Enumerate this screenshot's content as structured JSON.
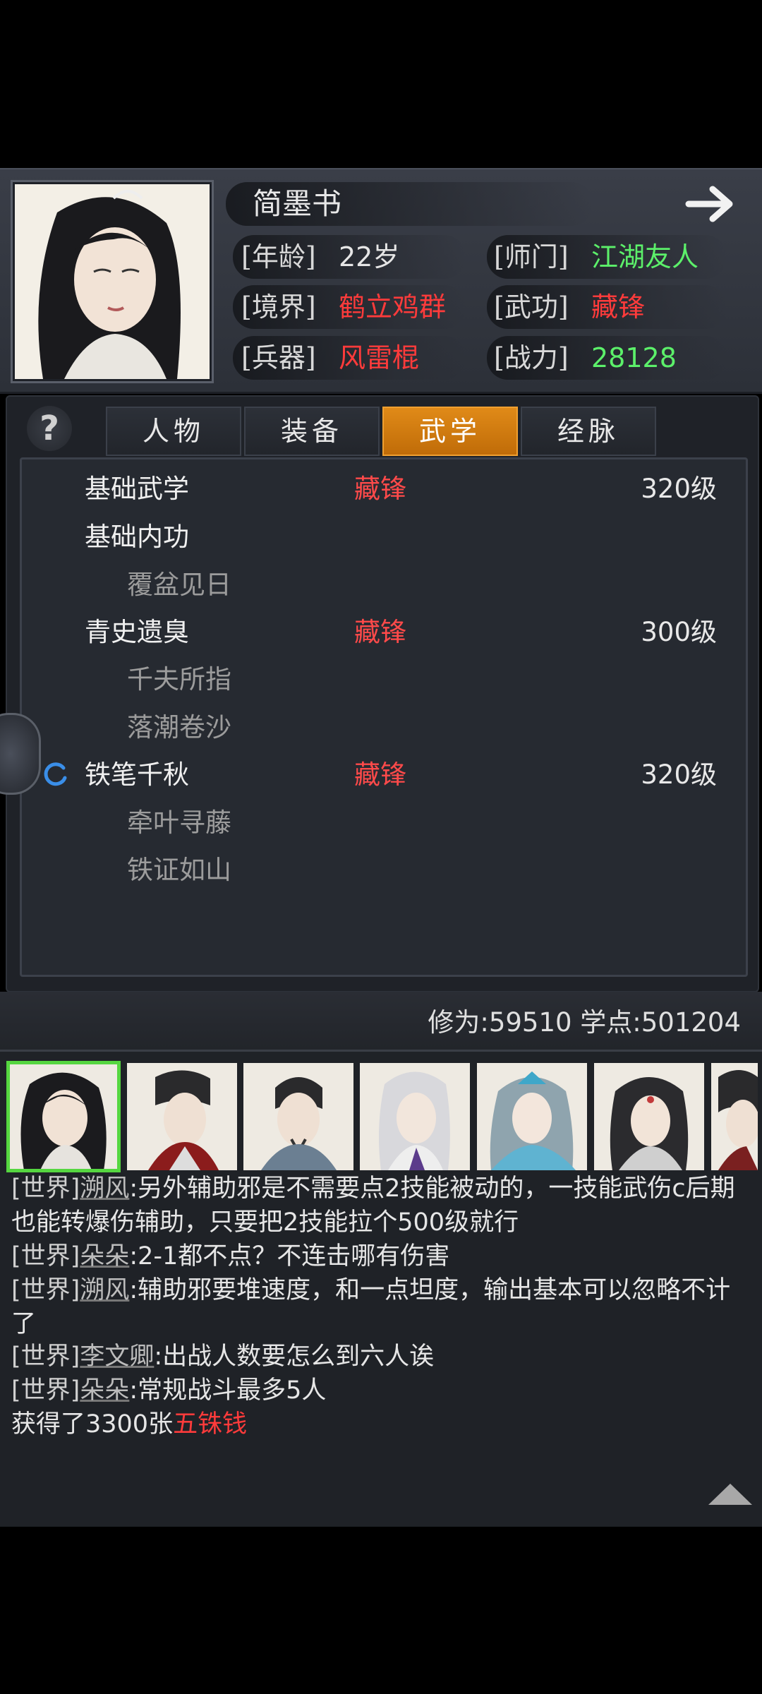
{
  "header": {
    "name": "简墨书",
    "fields": [
      {
        "label": "[年龄]",
        "value": "22岁"
      },
      {
        "label": "[师门]",
        "value": "江湖友人"
      },
      {
        "label": "[境界]",
        "value": "鹤立鸡群"
      },
      {
        "label": "[武功]",
        "value": "藏锋"
      },
      {
        "label": "[兵器]",
        "value": "风雷棍"
      },
      {
        "label": "[战力]",
        "value": "28128"
      }
    ]
  },
  "tabs": [
    {
      "label": "人物"
    },
    {
      "label": "装备"
    },
    {
      "label": "武学",
      "active": true
    },
    {
      "label": "经脉"
    }
  ],
  "help": "?",
  "skills": [
    {
      "name": "基础武学",
      "style": "藏锋",
      "level": "320级",
      "sub": false
    },
    {
      "name": "基础内功",
      "style": "",
      "level": "",
      "sub": false
    },
    {
      "name": "覆盆见日",
      "sub": true
    },
    {
      "name": "青史遗臭",
      "style": "藏锋",
      "level": "300级",
      "sub": false
    },
    {
      "name": "千夫所指",
      "sub": true
    },
    {
      "name": "落潮卷沙",
      "sub": true
    },
    {
      "name": "铁笔千秋",
      "style": "藏锋",
      "level": "320级",
      "sub": false
    },
    {
      "name": "牵叶寻藤",
      "sub": true
    },
    {
      "name": "铁证如山",
      "sub": true
    }
  ],
  "stats": {
    "text": "修为:59510  学点:501204"
  },
  "chat": [
    {
      "channel": "[世界]",
      "user": "溯风",
      "msg": ":另外辅助邪是不需要点2技能被动的，一技能武伤c后期也能转爆伤辅助，只要把2技能拉个500级就行"
    },
    {
      "channel": "[世界]",
      "user": "朵朵",
      "msg": ":2-1都不点？不连击哪有伤害"
    },
    {
      "channel": "[世界]",
      "user": "溯风",
      "msg": ":辅助邪要堆速度，和一点坦度，输出基本可以忽略不计了"
    },
    {
      "channel": "[世界]",
      "user": "李文卿",
      "msg": ":出战人数要怎么到六人诶"
    },
    {
      "channel": "[世界]",
      "user": "朵朵",
      "msg": ":常规战斗最多5人"
    }
  ],
  "reward": {
    "prefix": "获得了3300张",
    "item": "五铢钱"
  },
  "colors": {
    "accent_tab": "#e08a18",
    "green": "#5cf06a",
    "red": "#ff3b3b",
    "select_border": "#55d640"
  }
}
